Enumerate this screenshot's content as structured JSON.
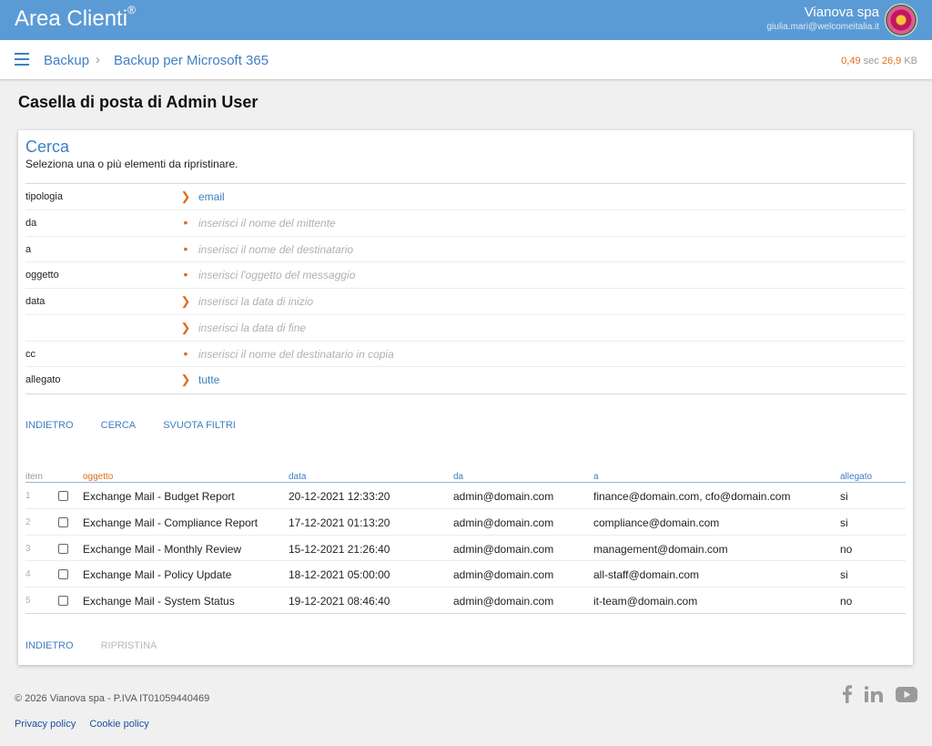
{
  "header": {
    "brand": "Area Clienti",
    "brand_mark": "®",
    "user_name": "Vianova spa",
    "user_email": "giulia.mari@welcomeitalia.it"
  },
  "nav": {
    "breadcrumb_1": "Backup",
    "breadcrumb_sep": "›",
    "breadcrumb_2": "Backup per Microsoft 365",
    "timing_sec": "0,49",
    "timing_sec_unit": "sec",
    "timing_kb": "26,9",
    "timing_kb_unit": "KB"
  },
  "page": {
    "title": "Casella di posta di Admin User"
  },
  "search": {
    "title": "Cerca",
    "subtitle": "Seleziona una o più elementi da ripristinare.",
    "rows": [
      {
        "label": "tipologia",
        "value": "email",
        "placeholder": false
      },
      {
        "label": "da",
        "value": "inserisci il nome del mittente",
        "placeholder": true
      },
      {
        "label": "a",
        "value": "inserisci il nome del destinatario",
        "placeholder": true
      },
      {
        "label": "oggetto",
        "value": "inserisci l'oggetto del messaggio",
        "placeholder": true
      },
      {
        "label": "data",
        "value": "inserisci la data di inizio",
        "placeholder": true
      },
      {
        "label": "",
        "value": "inserisci la data di fine",
        "placeholder": true
      },
      {
        "label": "cc",
        "value": "inserisci il nome del destinatario in copia",
        "placeholder": true
      },
      {
        "label": "allegato",
        "value": "tutte",
        "placeholder": false
      }
    ],
    "btn_back": "INDIETRO",
    "btn_search": "CERCA",
    "btn_clear": "SVUOTA FILTRI"
  },
  "table": {
    "headers": {
      "item": "item",
      "oggetto": "oggetto",
      "data": "data",
      "da": "da",
      "a": "a",
      "allegato": "allegato"
    },
    "header_colors": {
      "item": "#999999",
      "oggetto": "#e06c1e",
      "other": "#3f7fc2"
    },
    "rows": [
      {
        "n": "1",
        "oggetto": "Exchange Mail - Budget Report",
        "data": "20-12-2021 12:33:20",
        "da": "admin@domain.com",
        "a": "finance@domain.com, cfo@domain.com",
        "allegato": "si"
      },
      {
        "n": "2",
        "oggetto": "Exchange Mail - Compliance Report",
        "data": "17-12-2021 01:13:20",
        "da": "admin@domain.com",
        "a": "compliance@domain.com",
        "allegato": "si"
      },
      {
        "n": "3",
        "oggetto": "Exchange Mail - Monthly Review",
        "data": "15-12-2021 21:26:40",
        "da": "admin@domain.com",
        "a": "management@domain.com",
        "allegato": "no"
      },
      {
        "n": "4",
        "oggetto": "Exchange Mail - Policy Update",
        "data": "18-12-2021 05:00:00",
        "da": "admin@domain.com",
        "a": "all-staff@domain.com",
        "allegato": "si"
      },
      {
        "n": "5",
        "oggetto": "Exchange Mail - System Status",
        "data": "19-12-2021 08:46:40",
        "da": "admin@domain.com",
        "a": "it-team@domain.com",
        "allegato": "no"
      }
    ],
    "btn_back": "INDIETRO",
    "btn_restore": "RIPRISTINA"
  },
  "footer": {
    "copyright": "© 2026 Vianova spa - P.IVA IT01059440469",
    "privacy": "Privacy policy",
    "cookie": "Cookie policy",
    "social_icons": [
      "facebook-icon",
      "linkedin-icon",
      "youtube-icon"
    ]
  },
  "colors": {
    "topbar": "#5b9bd5",
    "accent": "#3f7fc2",
    "orange": "#e06c1e"
  }
}
